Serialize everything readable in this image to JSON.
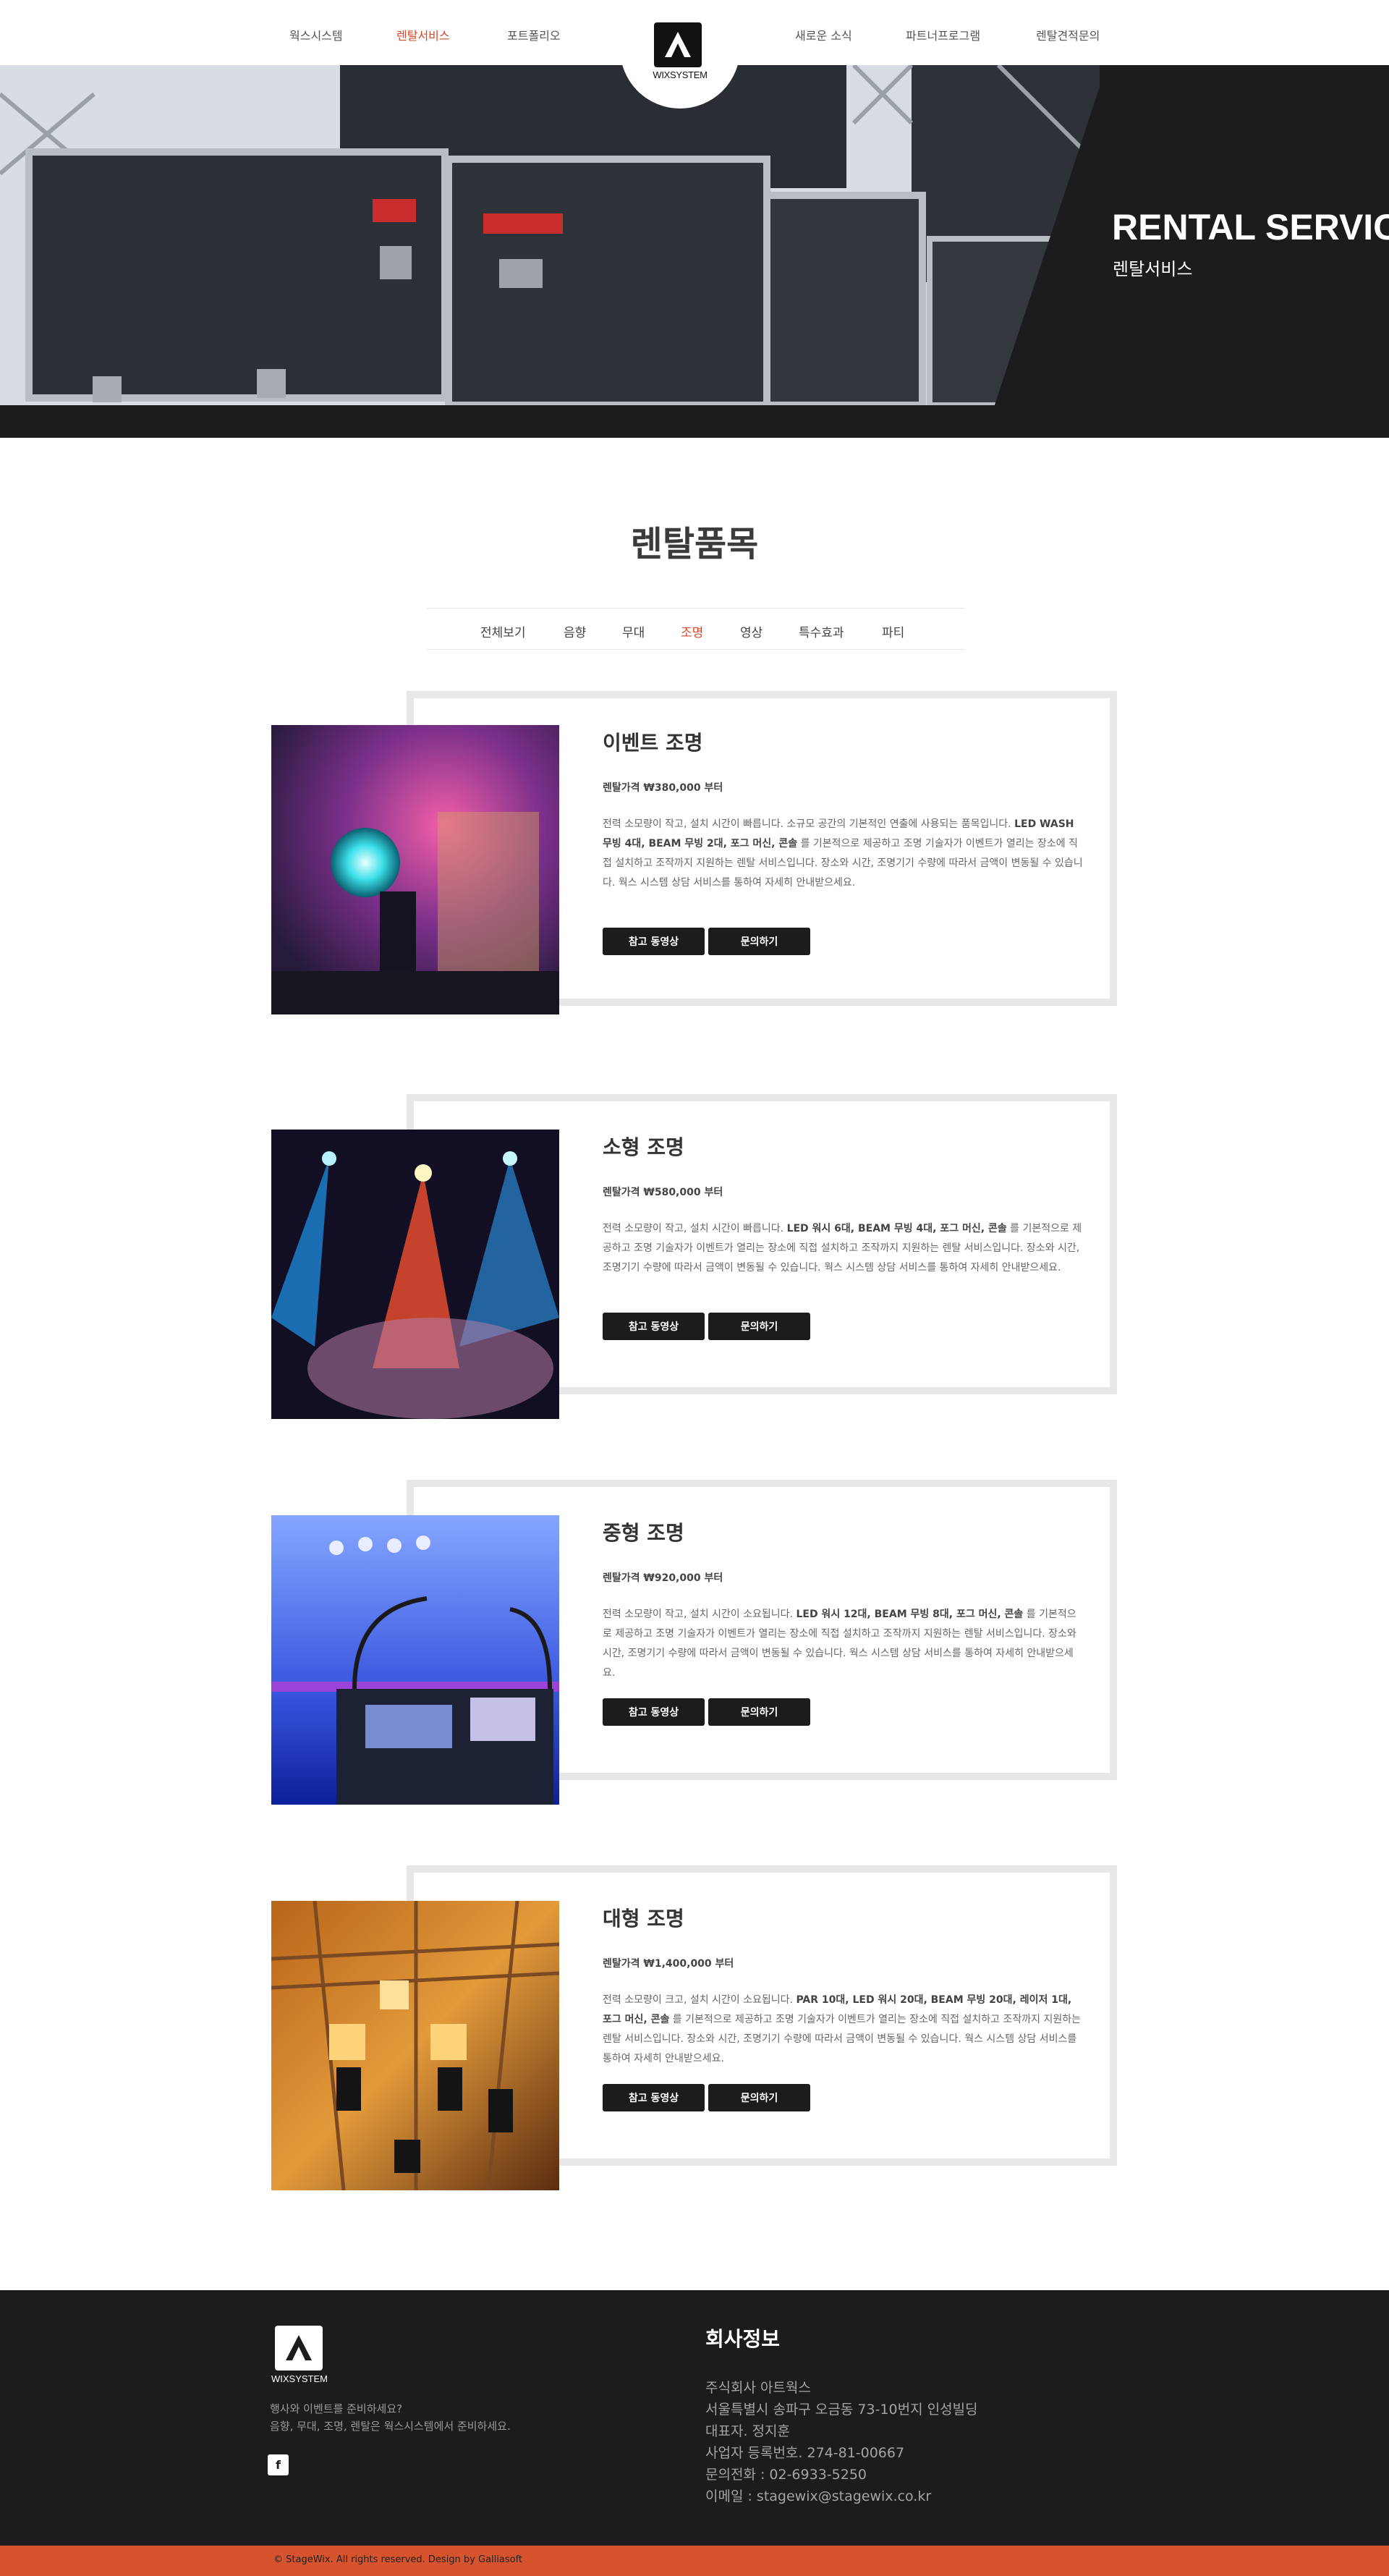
{
  "nav": {
    "left": [
      "웍스시스템",
      "렌탈서비스",
      "포트폴리오"
    ],
    "right": [
      "새로운 소식",
      "파트너프로그램",
      "렌탈견적문의"
    ],
    "logo_text": "WIXSYSTEM"
  },
  "hero": {
    "title": "RENTAL SERVICE",
    "subtitle": "렌탈서비스"
  },
  "section": {
    "title": "렌탈품목",
    "tabs": [
      "전체보기",
      "음향",
      "무대",
      "조명",
      "영상",
      "특수효과",
      "파티"
    ],
    "active_tab": "조명"
  },
  "products": [
    {
      "title": "이벤트 조명",
      "price": "렌탈가격 ₩380,000 부터",
      "desc": "전력 소모량이 작고, 설치 시간이 빠릅니다. 소규모 공간의 기본적인 연출에 사용되는 품목입니다. <b>LED WASH 무빙 4대, BEAM 무빙 2대, 포그 머신, 콘솔</b> 를 기본적으로 제공하고 조명 기술자가 이벤트가 열리는 장소에 직접 설치하고 조작까지 지원하는 렌탈 서비스입니다. 장소와 시간, 조명기기 수량에 따라서 금액이 변동될 수 있습니다. 웍스 시스템 상담 서비스를 통하여 자세히 안내받으세요.",
      "btn_video": "참고 동영상",
      "btn_inquiry": "문의하기"
    },
    {
      "title": "소형 조명",
      "price": "렌탈가격 ₩580,000 부터",
      "desc": "전력 소모량이 작고, 설치 시간이 빠릅니다. <b>LED 워시 6대, BEAM 무빙 4대, 포그 머신, 콘솔</b> 를 기본적으로 제공하고 조명 기술자가 이벤트가 열리는 장소에 직접 설치하고 조작까지 지원하는 렌탈 서비스입니다. 장소와 시간, 조명기기 수량에 따라서 금액이 변동될 수 있습니다. 웍스 시스템 상담 서비스를 통하여 자세히 안내받으세요.",
      "btn_video": "참고 동영상",
      "btn_inquiry": "문의하기"
    },
    {
      "title": "중형 조명",
      "price": "렌탈가격 ₩920,000 부터",
      "desc": "전력 소모량이 작고, 설치 시간이 소요됩니다. <b>LED 워시 12대, BEAM 무빙 8대, 포그 머신, 콘솔</b> 를 기본적으로 제공하고 조명 기술자가 이벤트가 열리는 장소에 직접 설치하고 조작까지 지원하는 렌탈 서비스입니다. 장소와 시간, 조명기기 수량에 따라서 금액이 변동될 수 있습니다. 웍스 시스템 상담 서비스를 통하여 자세히 안내받으세요.",
      "btn_video": "참고 동영상",
      "btn_inquiry": "문의하기"
    },
    {
      "title": "대형 조명",
      "price": "렌탈가격 ₩1,400,000 부터",
      "desc": "전력 소모량이 크고, 설치 시간이 소요됩니다. <b>PAR 10대, LED 워시 20대, BEAM 무빙 20대, 레이저 1대, 포그 머신, 콘솔</b> 를 기본적으로 제공하고 조명 기술자가 이벤트가 열리는 장소에 직접 설치하고 조작까지 지원하는 렌탈 서비스입니다. 장소와 시간, 조명기기 수량에 따라서 금액이 변동될 수 있습니다. 웍스 시스템 상담 서비스를 통하여 자세히 안내받으세요.",
      "btn_video": "참고 동영상",
      "btn_inquiry": "문의하기"
    }
  ],
  "footer": {
    "logo_text": "WIXSYSTEM",
    "tagline_1": "행사와 이벤트를 준비하세요?",
    "tagline_2": "음향, 무대, 조명, 렌탈은 웍스시스템에서 준비하세요.",
    "facebook_label": "f",
    "heading": "회사정보",
    "info": [
      "주식회사 아트웍스",
      "서울특별시 송파구 오금동 73-10번지 인성빌딩",
      "대표자. 정지훈",
      "사업자 등록번호. 274-81-00667",
      "문의전화 : 02-6933-5250",
      "이메일 : stagewix@stagewix.co.kr"
    ],
    "copyright": "© StageWix. All rights reserved. Design by Galliasoft"
  },
  "colors": {
    "accent": "#d6492b",
    "dark": "#1c1c1e",
    "footer_bar": "#d6532d",
    "frame": "#e7e7e7"
  }
}
